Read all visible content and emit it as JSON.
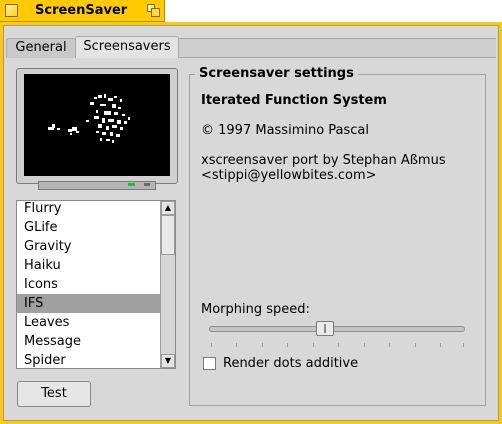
{
  "window": {
    "title": "ScreenSaver"
  },
  "tabs": [
    {
      "label": "General",
      "active": false
    },
    {
      "label": "Screensavers",
      "active": true
    }
  ],
  "screensaver_list": {
    "items": [
      "Flurry",
      "GLife",
      "Gravity",
      "Haiku",
      "Icons",
      "IFS",
      "Leaves",
      "Message",
      "Spider"
    ],
    "selected": "IFS"
  },
  "test_button": {
    "label": "Test"
  },
  "settings": {
    "legend": "Screensaver settings",
    "name": "Iterated Function System",
    "copyright": "© 1997 Massimino Pascal",
    "port_line1": "xscreensaver port by Stephan Aßmus",
    "port_line2": "<stippi@yellowbites.com>",
    "morphing_label": "Morphing speed:",
    "morphing_value": 0.45,
    "checkbox_label": "Render dots additive",
    "checkbox_checked": false
  },
  "colors": {
    "title_tab": "#ffcb00",
    "panel": "#d8d8d8",
    "selected_row": "#a0a0a0",
    "preview_bg": "#000000"
  }
}
